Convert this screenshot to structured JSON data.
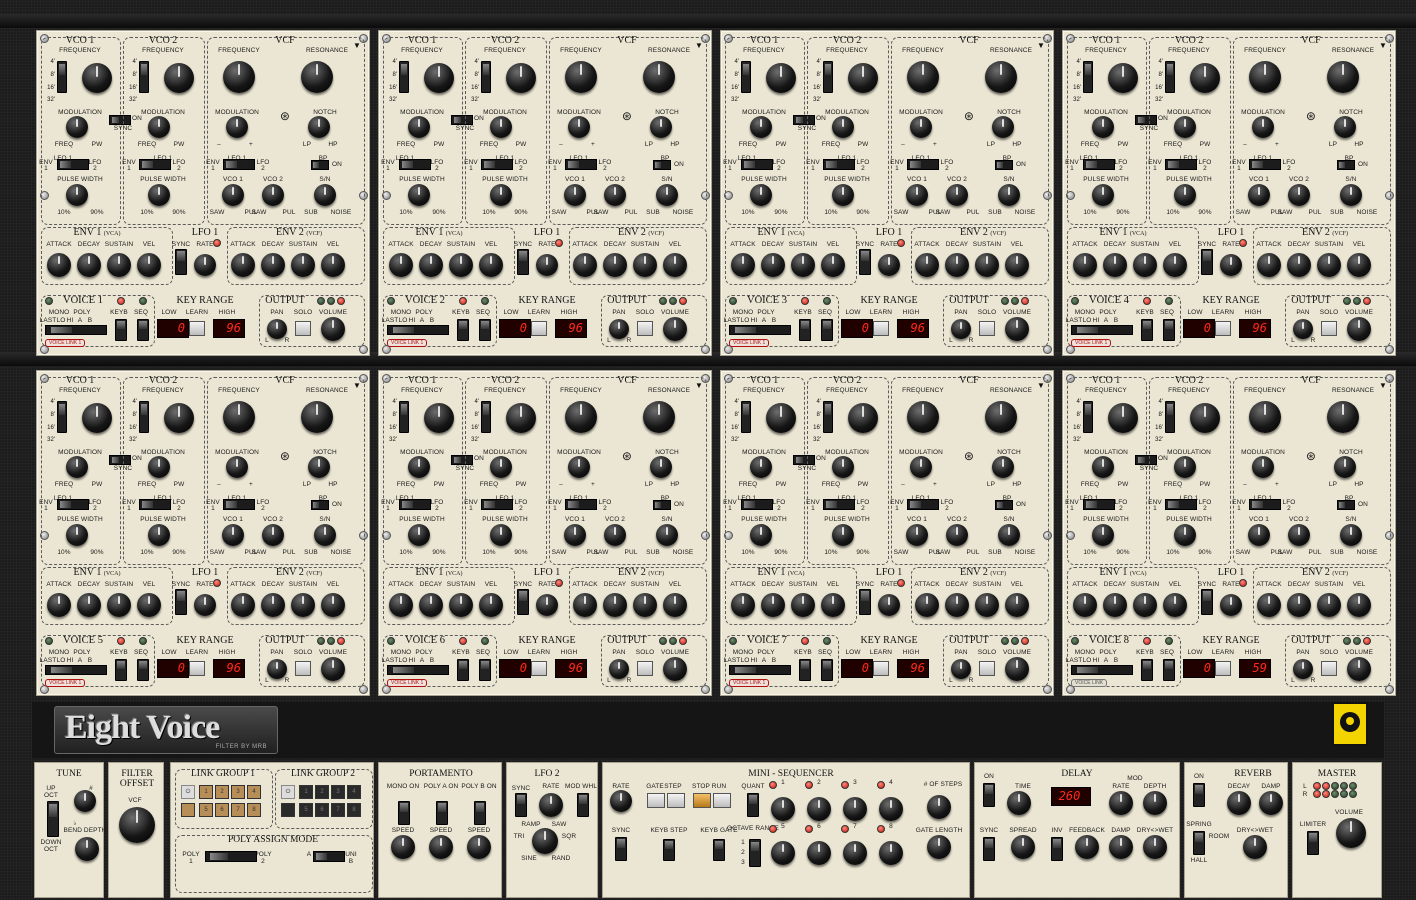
{
  "app": {
    "name": "Eight Voice",
    "subtitle": "FILTER BY MRB"
  },
  "voices": [
    {
      "n": 1,
      "title": "VOICE 1",
      "low": "0",
      "high": "96",
      "link": "VOICE LINK 1",
      "linkActive": true
    },
    {
      "n": 2,
      "title": "VOICE 2",
      "low": "0",
      "high": "96",
      "link": "VOICE LINK 1",
      "linkActive": true
    },
    {
      "n": 3,
      "title": "VOICE 3",
      "low": "0",
      "high": "96",
      "link": "VOICE LINK 1",
      "linkActive": true
    },
    {
      "n": 4,
      "title": "VOICE 4",
      "low": "0",
      "high": "96",
      "link": "VOICE LINK 1",
      "linkActive": true
    },
    {
      "n": 5,
      "title": "VOICE 5",
      "low": "0",
      "high": "96",
      "link": "VOICE LINK 1",
      "linkActive": true
    },
    {
      "n": 6,
      "title": "VOICE 6",
      "low": "0",
      "high": "96",
      "link": "VOICE LINK 1",
      "linkActive": true
    },
    {
      "n": 7,
      "title": "VOICE 7",
      "low": "0",
      "high": "96",
      "link": "VOICE LINK 1",
      "linkActive": true
    },
    {
      "n": 8,
      "title": "VOICE 8",
      "low": "0",
      "high": "59",
      "link": "VOICE LINK",
      "linkActive": false
    }
  ],
  "vlabels": {
    "vco1": "VCO 1",
    "vco2": "VCO 2",
    "vcf": "VCF",
    "frequency": "FREQUENCY",
    "resonance": "RESONANCE",
    "octaves": [
      "4'",
      "8'",
      "16'",
      "32'"
    ],
    "modulation": "MODULATION",
    "freq": "FREQ",
    "pw": "PW",
    "on": "ON",
    "sync": "SYNC",
    "lfo1": "LFO 1",
    "env": "ENV",
    "one": "1",
    "two": "2",
    "lfo": "LFO",
    "pulse_width": "PULSE WIDTH",
    "p10": "10%",
    "p90": "90%",
    "minus": "–",
    "plus": "+",
    "notch": "NOTCH",
    "lp": "LP",
    "hp": "HP",
    "bp": "BP",
    "saw": "SAW",
    "pul": "PUL",
    "sn": "S/N",
    "sub": "SUB",
    "noise": "NOISE",
    "env1": "ENV 1",
    "vca": "(VCA)",
    "env2": "ENV 2",
    "vcf_s": "(VCF)",
    "attack": "ATTACK",
    "decay": "DECAY",
    "sustain": "SUSTAIN",
    "vel": "VEL",
    "rate": "RATE",
    "key_range": "KEY RANGE",
    "low": "LOW",
    "learn": "LEARN",
    "high": "HIGH",
    "output": "OUTPUT",
    "pan": "PAN",
    "solo": "SOLO",
    "volume": "VOLUME",
    "l": "L",
    "r": "R",
    "mono": "MONO",
    "poly": "POLY",
    "last": "LAST",
    "lo": "LO",
    "hi": "HI",
    "a": "A",
    "b": "B",
    "keyb": "KEYB",
    "seq": "SEQ"
  },
  "global": {
    "tune": {
      "title": "TUNE",
      "up": "UP",
      "down": "DOWN",
      "oct": "OCT",
      "sharp": "#",
      "flat": "♭",
      "bend": "BEND DEPTH"
    },
    "filter_offset": {
      "title1": "FILTER",
      "title2": "OFFSET",
      "vcf": "VCF"
    },
    "link1": {
      "title": "LINK GROUP 1",
      "pads": [
        "1",
        "2",
        "3",
        "4",
        "5",
        "6",
        "7",
        "8"
      ]
    },
    "link2": {
      "title": "LINK GROUP 2",
      "pads": [
        "1",
        "2",
        "3",
        "4",
        "5",
        "6",
        "7",
        "8"
      ]
    },
    "poly_assign": {
      "title": "POLY ASSIGN MODE",
      "poly1": "POLY",
      "poly2": "POLY",
      "uni": "UNI",
      "one": "1",
      "two": "2",
      "a": "A",
      "b": "B"
    },
    "portamento": {
      "title": "PORTAMENTO",
      "mono_on": "MONO ON",
      "polya_on": "POLY A ON",
      "polyb_on": "POLY B ON",
      "speed": "SPEED"
    },
    "lfo2": {
      "title": "LFO 2",
      "sync": "SYNC",
      "rate": "RATE",
      "mod_whl": "MOD WHL",
      "ramp": "RAMP",
      "saw": "SAW",
      "tri": "TRI",
      "sqr": "SQR",
      "sine": "SINE",
      "rand": "RAND"
    },
    "seq": {
      "title": "MINI - SEQUENCER",
      "rate": "RATE",
      "gate": "GATE",
      "step": "STEP",
      "stop": "STOP",
      "run": "RUN",
      "quant": "QUANT",
      "sync": "SYNC",
      "keyb_step": "KEYB STEP",
      "keyb_gate": "KEYB GATE",
      "octave": "OCTAVE RANGE",
      "steps": "# OF STEPS",
      "gate_length": "GATE LENGTH",
      "nums": [
        "1",
        "2",
        "3",
        "4",
        "5",
        "6",
        "7",
        "8"
      ],
      "oct_nums": [
        "1",
        "2",
        "3"
      ]
    },
    "delay": {
      "title": "DELAY",
      "on": "ON",
      "time": "TIME",
      "value": "260",
      "rate": "RATE",
      "mod": "MOD",
      "depth": "DEPTH",
      "sync": "SYNC",
      "spread": "SPREAD",
      "inv": "INV",
      "feedback": "FEEDBACK",
      "damp": "DAMP",
      "drywet": "DRY<>WET"
    },
    "reverb": {
      "title": "REVERB",
      "on": "ON",
      "decay": "DECAY",
      "damp": "DAMP",
      "spring": "SPRING",
      "room": "ROOM",
      "hall": "HALL",
      "drywet": "DRY<>WET"
    },
    "master": {
      "title": "MASTER",
      "l": "L",
      "r": "R",
      "volume": "VOLUME",
      "limiter": "LIMITER"
    }
  },
  "colors": {
    "panel": "#ebe6d3",
    "led_red": "#d0150b",
    "segment": "#ff2a1a",
    "badge": "#f3d400"
  }
}
